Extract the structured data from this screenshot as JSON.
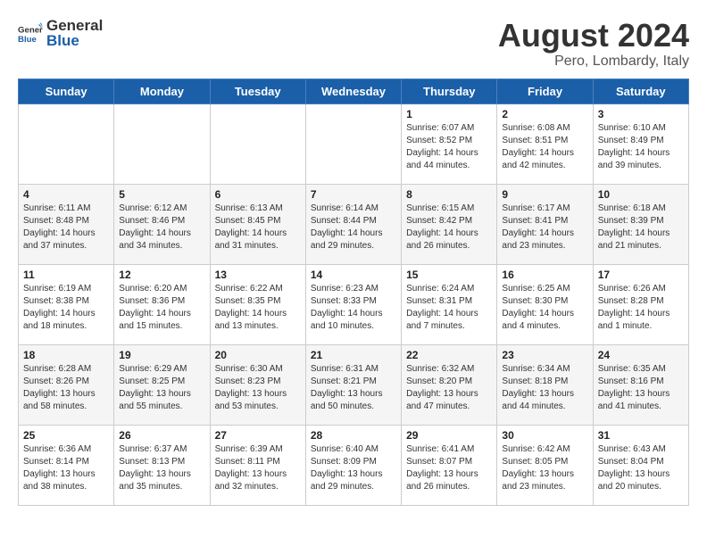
{
  "header": {
    "logo_general": "General",
    "logo_blue": "Blue",
    "month_year": "August 2024",
    "location": "Pero, Lombardy, Italy"
  },
  "days_of_week": [
    "Sunday",
    "Monday",
    "Tuesday",
    "Wednesday",
    "Thursday",
    "Friday",
    "Saturday"
  ],
  "weeks": [
    [
      {
        "day": "",
        "info": ""
      },
      {
        "day": "",
        "info": ""
      },
      {
        "day": "",
        "info": ""
      },
      {
        "day": "",
        "info": ""
      },
      {
        "day": "1",
        "info": "Sunrise: 6:07 AM\nSunset: 8:52 PM\nDaylight: 14 hours\nand 44 minutes."
      },
      {
        "day": "2",
        "info": "Sunrise: 6:08 AM\nSunset: 8:51 PM\nDaylight: 14 hours\nand 42 minutes."
      },
      {
        "day": "3",
        "info": "Sunrise: 6:10 AM\nSunset: 8:49 PM\nDaylight: 14 hours\nand 39 minutes."
      }
    ],
    [
      {
        "day": "4",
        "info": "Sunrise: 6:11 AM\nSunset: 8:48 PM\nDaylight: 14 hours\nand 37 minutes."
      },
      {
        "day": "5",
        "info": "Sunrise: 6:12 AM\nSunset: 8:46 PM\nDaylight: 14 hours\nand 34 minutes."
      },
      {
        "day": "6",
        "info": "Sunrise: 6:13 AM\nSunset: 8:45 PM\nDaylight: 14 hours\nand 31 minutes."
      },
      {
        "day": "7",
        "info": "Sunrise: 6:14 AM\nSunset: 8:44 PM\nDaylight: 14 hours\nand 29 minutes."
      },
      {
        "day": "8",
        "info": "Sunrise: 6:15 AM\nSunset: 8:42 PM\nDaylight: 14 hours\nand 26 minutes."
      },
      {
        "day": "9",
        "info": "Sunrise: 6:17 AM\nSunset: 8:41 PM\nDaylight: 14 hours\nand 23 minutes."
      },
      {
        "day": "10",
        "info": "Sunrise: 6:18 AM\nSunset: 8:39 PM\nDaylight: 14 hours\nand 21 minutes."
      }
    ],
    [
      {
        "day": "11",
        "info": "Sunrise: 6:19 AM\nSunset: 8:38 PM\nDaylight: 14 hours\nand 18 minutes."
      },
      {
        "day": "12",
        "info": "Sunrise: 6:20 AM\nSunset: 8:36 PM\nDaylight: 14 hours\nand 15 minutes."
      },
      {
        "day": "13",
        "info": "Sunrise: 6:22 AM\nSunset: 8:35 PM\nDaylight: 14 hours\nand 13 minutes."
      },
      {
        "day": "14",
        "info": "Sunrise: 6:23 AM\nSunset: 8:33 PM\nDaylight: 14 hours\nand 10 minutes."
      },
      {
        "day": "15",
        "info": "Sunrise: 6:24 AM\nSunset: 8:31 PM\nDaylight: 14 hours\nand 7 minutes."
      },
      {
        "day": "16",
        "info": "Sunrise: 6:25 AM\nSunset: 8:30 PM\nDaylight: 14 hours\nand 4 minutes."
      },
      {
        "day": "17",
        "info": "Sunrise: 6:26 AM\nSunset: 8:28 PM\nDaylight: 14 hours\nand 1 minute."
      }
    ],
    [
      {
        "day": "18",
        "info": "Sunrise: 6:28 AM\nSunset: 8:26 PM\nDaylight: 13 hours\nand 58 minutes."
      },
      {
        "day": "19",
        "info": "Sunrise: 6:29 AM\nSunset: 8:25 PM\nDaylight: 13 hours\nand 55 minutes."
      },
      {
        "day": "20",
        "info": "Sunrise: 6:30 AM\nSunset: 8:23 PM\nDaylight: 13 hours\nand 53 minutes."
      },
      {
        "day": "21",
        "info": "Sunrise: 6:31 AM\nSunset: 8:21 PM\nDaylight: 13 hours\nand 50 minutes."
      },
      {
        "day": "22",
        "info": "Sunrise: 6:32 AM\nSunset: 8:20 PM\nDaylight: 13 hours\nand 47 minutes."
      },
      {
        "day": "23",
        "info": "Sunrise: 6:34 AM\nSunset: 8:18 PM\nDaylight: 13 hours\nand 44 minutes."
      },
      {
        "day": "24",
        "info": "Sunrise: 6:35 AM\nSunset: 8:16 PM\nDaylight: 13 hours\nand 41 minutes."
      }
    ],
    [
      {
        "day": "25",
        "info": "Sunrise: 6:36 AM\nSunset: 8:14 PM\nDaylight: 13 hours\nand 38 minutes."
      },
      {
        "day": "26",
        "info": "Sunrise: 6:37 AM\nSunset: 8:13 PM\nDaylight: 13 hours\nand 35 minutes."
      },
      {
        "day": "27",
        "info": "Sunrise: 6:39 AM\nSunset: 8:11 PM\nDaylight: 13 hours\nand 32 minutes."
      },
      {
        "day": "28",
        "info": "Sunrise: 6:40 AM\nSunset: 8:09 PM\nDaylight: 13 hours\nand 29 minutes."
      },
      {
        "day": "29",
        "info": "Sunrise: 6:41 AM\nSunset: 8:07 PM\nDaylight: 13 hours\nand 26 minutes."
      },
      {
        "day": "30",
        "info": "Sunrise: 6:42 AM\nSunset: 8:05 PM\nDaylight: 13 hours\nand 23 minutes."
      },
      {
        "day": "31",
        "info": "Sunrise: 6:43 AM\nSunset: 8:04 PM\nDaylight: 13 hours\nand 20 minutes."
      }
    ]
  ]
}
